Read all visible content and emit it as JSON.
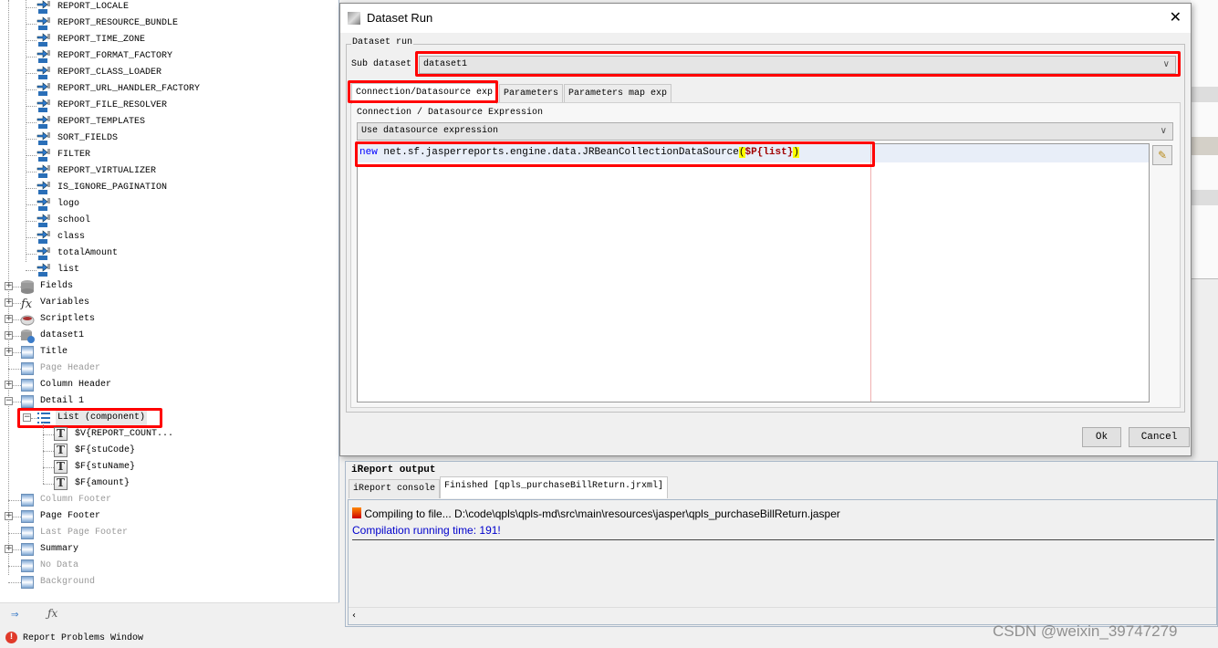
{
  "tree": {
    "parameters": [
      "REPORT_LOCALE",
      "REPORT_RESOURCE_BUNDLE",
      "REPORT_TIME_ZONE",
      "REPORT_FORMAT_FACTORY",
      "REPORT_CLASS_LOADER",
      "REPORT_URL_HANDLER_FACTORY",
      "REPORT_FILE_RESOLVER",
      "REPORT_TEMPLATES",
      "SORT_FIELDS",
      "FILTER",
      "REPORT_VIRTUALIZER",
      "IS_IGNORE_PAGINATION",
      "logo",
      "school",
      "class",
      "totalAmount",
      "list"
    ],
    "nodes": [
      {
        "label": "Fields",
        "icon": "database-icon",
        "expander": "+",
        "enabled": true
      },
      {
        "label": "Variables",
        "icon": "function-icon",
        "expander": "+",
        "enabled": true
      },
      {
        "label": "Scriptlets",
        "icon": "coffee-cup-icon",
        "expander": "+",
        "enabled": true
      },
      {
        "label": "dataset1",
        "icon": "dataset-icon",
        "expander": "+",
        "enabled": true
      },
      {
        "label": "Title",
        "icon": "band-icon",
        "expander": "+",
        "enabled": true
      },
      {
        "label": "Page Header",
        "icon": "band-icon",
        "expander": "",
        "enabled": false
      },
      {
        "label": "Column Header",
        "icon": "band-icon",
        "expander": "+",
        "enabled": true
      },
      {
        "label": "Detail 1",
        "icon": "band-icon",
        "expander": "-",
        "enabled": true
      }
    ],
    "list_component": "List (component)",
    "list_children": [
      "$V{REPORT_COUNT...",
      "$F{stuCode}",
      "$F{stuName}",
      "$F{amount}"
    ],
    "nodes_after": [
      {
        "label": "Column Footer",
        "expander": "",
        "enabled": false
      },
      {
        "label": "Page Footer",
        "expander": "+",
        "enabled": true
      },
      {
        "label": "Last Page Footer",
        "expander": "",
        "enabled": false
      },
      {
        "label": "Summary",
        "expander": "+",
        "enabled": true
      },
      {
        "label": "No Data",
        "expander": "",
        "enabled": false
      },
      {
        "label": "Background",
        "expander": "",
        "enabled": false
      }
    ]
  },
  "problems_window": "Report Problems Window",
  "dialog": {
    "title": "Dataset Run",
    "group_label": "Dataset run",
    "sub_dataset_label": "Sub dataset",
    "sub_dataset_value": "dataset1",
    "tabs": [
      "Connection/Datasource exp",
      "Parameters",
      "Parameters map exp"
    ],
    "active_tab": "Connection/Datasource exp",
    "expr_label": "Connection / Datasource Expression",
    "expr_type": "Use datasource expression",
    "expression": {
      "keyword": "new",
      "body": " net.sf.jasperreports.engine.data.JRBeanCollectionDataSource",
      "open": "(",
      "param": "$P{list}",
      "close": ")"
    },
    "ok": "Ok",
    "cancel": "Cancel"
  },
  "output": {
    "title": "iReport output",
    "tabs": [
      "iReport console",
      "Finished [qpls_purchaseBillReturn.jrxml]"
    ],
    "active_tab": "Finished [qpls_purchaseBillReturn.jrxml]",
    "line1": "Compiling to file... D:\\code\\qpls\\qpls-md\\src\\main\\resources\\jasper\\qpls_purchaseBillReturn.jasper",
    "line2": "Compilation running time: 191!"
  },
  "watermark": "CSDN @weixin_39747279",
  "colors": {
    "highlight_red": "#ff0000",
    "keyword_blue": "#0000ff",
    "param_red": "#a00000",
    "bracket_yellow": "#ffff00",
    "compile_blue": "#0000cc"
  }
}
